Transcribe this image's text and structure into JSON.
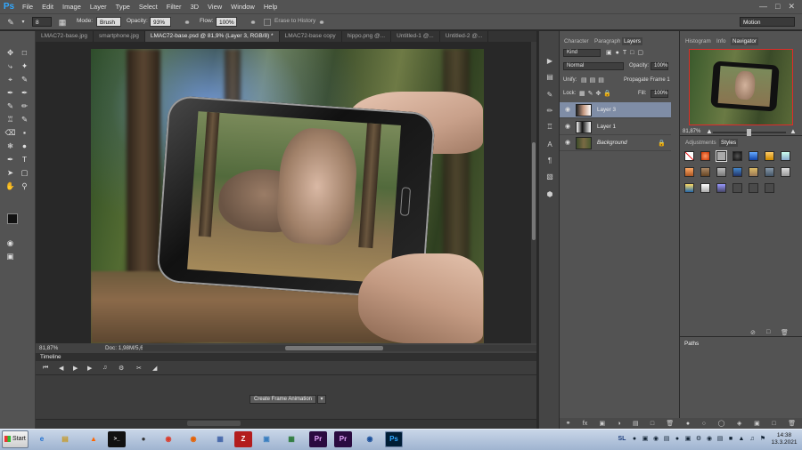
{
  "app": {
    "logo": "Ps"
  },
  "menu": [
    "File",
    "Edit",
    "Image",
    "Layer",
    "Type",
    "Select",
    "Filter",
    "3D",
    "View",
    "Window",
    "Help"
  ],
  "options": {
    "brush_size": "8",
    "mode_label": "Mode:",
    "mode_value": "Brush",
    "opacity_label": "Opacity:",
    "opacity_value": "93%",
    "flow_label": "Flow:",
    "flow_value": "100%",
    "erase_history": "Erase to History",
    "workspace": "Motion"
  },
  "tabs": [
    {
      "label": "LMAC72-base.jpg"
    },
    {
      "label": "smartphone.jpg"
    },
    {
      "label": "LMAC72-base.psd @ 81,9% (Layer 3, RGB/8) *",
      "active": true
    },
    {
      "label": "LMAC72-base copy"
    },
    {
      "label": "hippo.png @..."
    },
    {
      "label": "Untitled-1 @..."
    },
    {
      "label": "Untitled-2 @..."
    }
  ],
  "status": {
    "zoom": "81,87%",
    "doc": "Doc: 1,98M/5,61M"
  },
  "timeline": {
    "title": "Timeline",
    "create_frame": "Create Frame Animation"
  },
  "layers_panel": {
    "tabs": [
      "Character",
      "Paragraph",
      "Layers"
    ],
    "filter": "Kind",
    "blend_mode": "Normal",
    "opacity_label": "Opacity:",
    "opacity_value": "100%",
    "unify_label": "Unify:",
    "propagate": "Propagate Frame 1",
    "lock_label": "Lock:",
    "fill_label": "Fill:",
    "fill_value": "100%",
    "layers": [
      {
        "name": "Layer 3",
        "active": true
      },
      {
        "name": "Layer 1"
      },
      {
        "name": "Background",
        "italic": true
      }
    ]
  },
  "right_panel": {
    "tabs_top": [
      "Histogram",
      "Info",
      "Navigator"
    ],
    "nav_zoom": "81,87%",
    "tabs_mid": [
      "Adjustments",
      "Styles"
    ],
    "paths": "Paths"
  },
  "taskbar": {
    "start": "Start",
    "lang": "SL",
    "time": "14:38",
    "date": "13.3.2021"
  },
  "colors": {
    "ps_blue": "#31a8ff",
    "active_layer": "#7f8da6",
    "navigator_box": "#e02a2a"
  }
}
